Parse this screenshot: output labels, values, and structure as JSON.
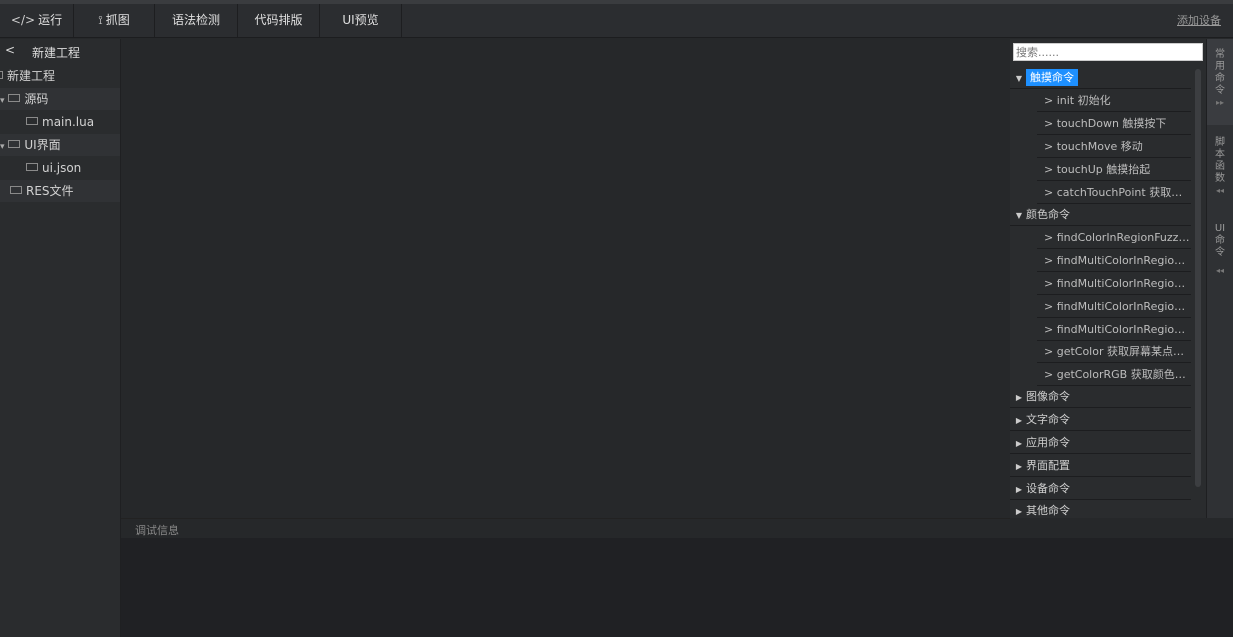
{
  "toolbar": {
    "run": "运行",
    "capture": "抓图",
    "syntax": "语法检测",
    "format": "代码排版",
    "preview": "UI预览",
    "add_device": "添加设备"
  },
  "project": {
    "back": "<",
    "title": "新建工程",
    "tree": {
      "root": "新建工程",
      "src": "源码",
      "main_lua": "main.lua",
      "ui_folder": "UI界面",
      "ui_json": "ui.json",
      "res": "RES文件"
    }
  },
  "debug": {
    "title": "调试信息"
  },
  "commands": {
    "search_placeholder": "搜索......",
    "categories": {
      "touch": "触摸命令",
      "color": "颜色命令",
      "image": "图像命令",
      "text": "文字命令",
      "app": "应用命令",
      "ui_config": "界面配置",
      "device": "设备命令",
      "other": "其他命令"
    },
    "touch_items": [
      "> init 初始化",
      "> touchDown 触摸按下",
      "> touchMove 移动",
      "> touchUp 触摸抬起",
      "> catchTouchPoint 获取用..."
    ],
    "color_items": [
      "> findColorInRegionFuzzy ...",
      "> findMultiColorInRegionF...",
      "> findMultiColorInRegionF...",
      "> findMultiColorInRegionF...",
      "> findMultiColorInRegionF...",
      "> getColor 获取屏幕某点颜...",
      "> getColorRGB 获取颜色R..."
    ]
  },
  "side_tabs": {
    "common": [
      "常",
      "用",
      "命",
      "令"
    ],
    "script": [
      "脚",
      "本",
      "函",
      "数"
    ],
    "ui": [
      "UI",
      "命",
      "令"
    ]
  },
  "colors": {
    "accent": "#1e90ff",
    "background": "#26282a"
  }
}
